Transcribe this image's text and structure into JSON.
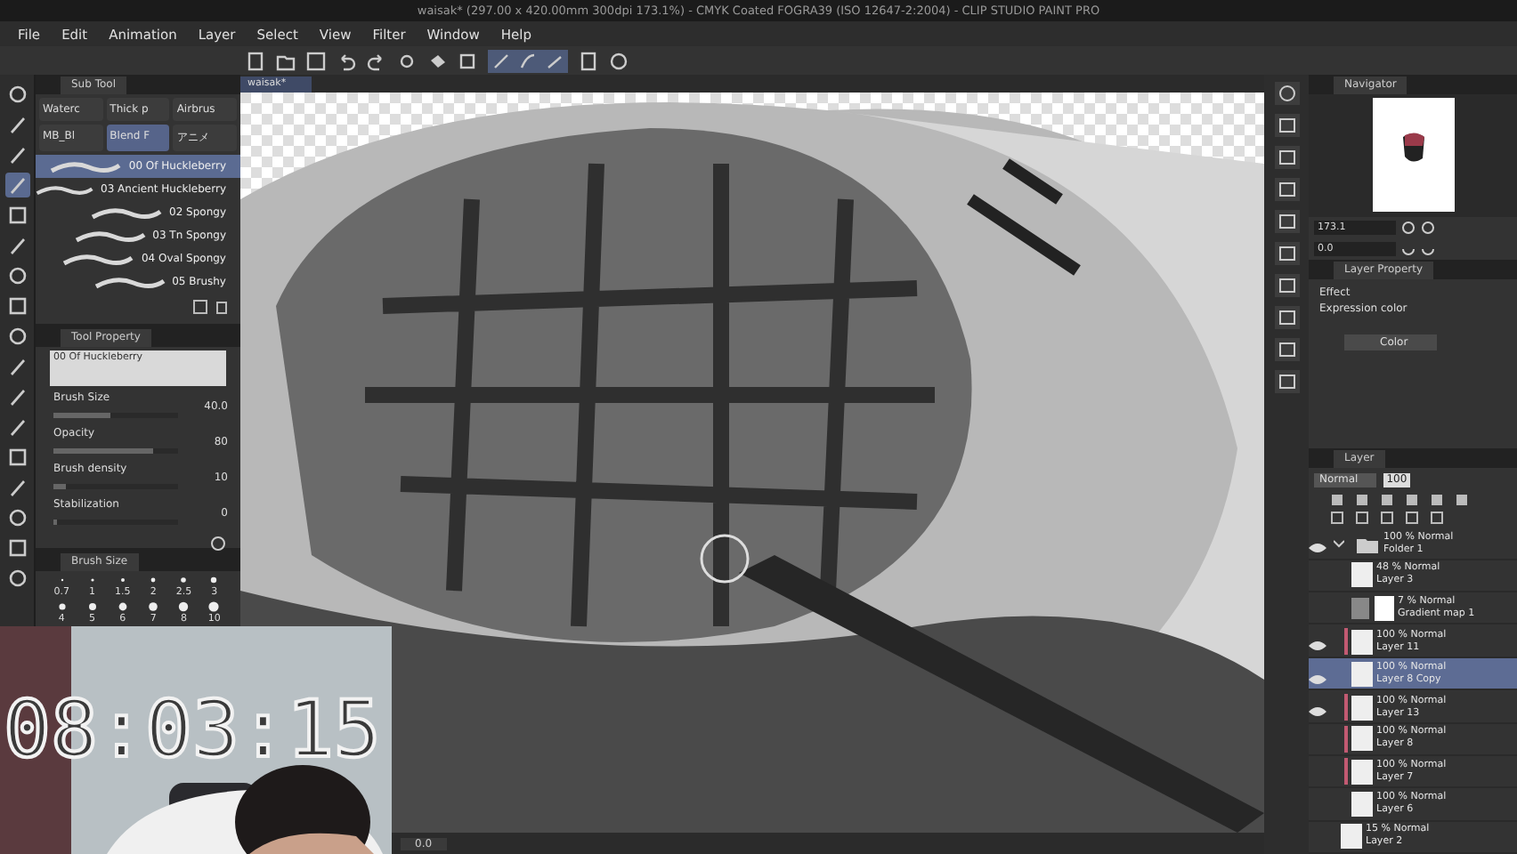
{
  "window": {
    "title": "waisak* (297.00 x 420.00mm 300dpi 173.1%) - CMYK Coated FOGRA39 (ISO 12647-2:2004) - CLIP STUDIO PAINT PRO"
  },
  "menu": [
    "File",
    "Edit",
    "Animation",
    "Layer",
    "Select",
    "View",
    "Filter",
    "Window",
    "Help"
  ],
  "tools": [
    {
      "selected": false
    },
    {
      "selected": false
    },
    {
      "selected": false
    },
    {
      "selected": true
    },
    {
      "selected": false
    },
    {
      "selected": false
    },
    {
      "selected": false
    },
    {
      "selected": false
    },
    {
      "selected": false
    },
    {
      "selected": false
    },
    {
      "selected": false
    },
    {
      "selected": false
    },
    {
      "selected": false
    },
    {
      "selected": false
    },
    {
      "selected": false
    },
    {
      "selected": false
    },
    {
      "selected": false
    }
  ],
  "sub_tool": {
    "title": "Sub Tool",
    "tabs": [
      {
        "label": "Waterc",
        "selected": false
      },
      {
        "label": "Thick p",
        "selected": false
      },
      {
        "label": "Airbrus",
        "selected": false
      },
      {
        "label": "MB_Bl",
        "selected": false
      },
      {
        "label": "Blend F",
        "selected": true
      },
      {
        "label": "アニメ",
        "selected": false
      }
    ],
    "brushes": [
      {
        "name": "00 Of Huckleberry",
        "selected": true
      },
      {
        "name": "03 Ancient Huckleberry",
        "selected": false
      },
      {
        "name": "02 Spongy",
        "selected": false
      },
      {
        "name": "03 Tn Spongy",
        "selected": false
      },
      {
        "name": "04 Oval Spongy",
        "selected": false
      },
      {
        "name": "05 Brushy",
        "selected": false
      }
    ]
  },
  "tool_property": {
    "title": "Tool Property",
    "brush": "00 Of Huckleberry",
    "properties": [
      {
        "name": "Brush Size",
        "value": "40.0",
        "level": 0.45
      },
      {
        "name": "Opacity",
        "value": "80",
        "level": 0.8
      },
      {
        "name": "Brush density",
        "value": "10",
        "level": 0.1
      },
      {
        "name": "Stabilization",
        "value": "0",
        "level": 0
      }
    ]
  },
  "brush_size": {
    "title": "Brush Size",
    "sizes": [
      "0.7",
      "1",
      "1.5",
      "2",
      "2.5",
      "3",
      "4",
      "5",
      "6",
      "7",
      "8",
      "10"
    ]
  },
  "canvas": {
    "tab": "waisak*",
    "angle": "0.0"
  },
  "navigator": {
    "title": "Navigator",
    "zoom": "173.1",
    "rotation": "0.0"
  },
  "layer_property": {
    "title": "Layer Property",
    "effect_label": "Effect",
    "expression_label": "Expression color",
    "expression_value": "Color"
  },
  "layer_panel": {
    "title": "Layer",
    "blend": "Normal",
    "opacity": "100",
    "layers": [
      {
        "kind": "folder",
        "mode": "100 % Normal",
        "name": "Folder 1",
        "visible": true,
        "expanded": true,
        "selected": false,
        "children": [
          {
            "kind": "raster",
            "mode": "48 % Normal",
            "name": "Layer 3",
            "visible": false,
            "selected": false
          },
          {
            "kind": "gradient",
            "mode": "7 % Normal",
            "name": "Gradient map 1",
            "visible": false,
            "selected": false
          },
          {
            "kind": "raster",
            "mode": "100 % Normal",
            "name": "Layer 11",
            "visible": true,
            "selected": false,
            "color": "#c25a72"
          },
          {
            "kind": "raster",
            "mode": "100 % Normal",
            "name": "Layer 8 Copy",
            "visible": true,
            "selected": true
          },
          {
            "kind": "raster",
            "mode": "100 % Normal",
            "name": "Layer 13",
            "visible": true,
            "selected": false,
            "color": "#c25a72"
          },
          {
            "kind": "raster",
            "mode": "100 % Normal",
            "name": "Layer 8",
            "visible": false,
            "selected": false,
            "color": "#c25a72"
          },
          {
            "kind": "raster",
            "mode": "100 % Normal",
            "name": "Layer 7",
            "visible": false,
            "selected": false,
            "color": "#c25a72"
          },
          {
            "kind": "raster",
            "mode": "100 % Normal",
            "name": "Layer 6",
            "visible": false,
            "selected": false
          }
        ]
      },
      {
        "kind": "raster",
        "mode": "15 % Normal",
        "name": "Layer 2",
        "visible": false,
        "selected": false
      }
    ]
  },
  "timer": "08:03:15"
}
